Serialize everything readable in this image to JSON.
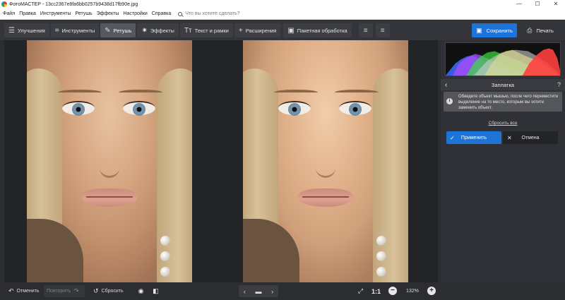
{
  "window": {
    "title": "ФотоМАСТЕР - 13cc2367e8fa6bb0257b9438d17fb90e.jpg",
    "controls": [
      "—",
      "☐",
      "✕"
    ]
  },
  "menu": {
    "items": [
      "Файл",
      "Правка",
      "Инструменты",
      "Ретушь",
      "Эффекты",
      "Настройки",
      "Справка"
    ],
    "search_placeholder": "Что вы хотите сделать?"
  },
  "toolbar": {
    "tabs": [
      {
        "label": "Улучшения",
        "icon": "sliders-icon",
        "glyph": "☰"
      },
      {
        "label": "Инструменты",
        "icon": "crop-icon",
        "glyph": "⌗"
      },
      {
        "label": "Ретушь",
        "icon": "brush-icon",
        "glyph": "✎"
      },
      {
        "label": "Эффекты",
        "icon": "magic-wand-icon",
        "glyph": "✷"
      },
      {
        "label": "Текст и рамки",
        "icon": "text-icon",
        "glyph": "Tт"
      },
      {
        "label": "Расширения",
        "icon": "plus-icon",
        "glyph": "+"
      }
    ],
    "active_tab": "Ретушь",
    "batch_label": "Пакетная обработка",
    "save_label": "Сохранить",
    "print_label": "Печать"
  },
  "panel": {
    "title": "Заплатка",
    "help": "?",
    "hint": "Обведите объект мышью, после чего переместите выделение на то место, которым вы хотите заменить объект.",
    "reset_all": "Сбросить все",
    "apply": "Применить",
    "cancel": "Отмена"
  },
  "bottom": {
    "undo": "Отменить",
    "redo": "Повторить",
    "reset": "Сбросить",
    "ratio": "1:1",
    "zoom": "132%"
  },
  "colors": {
    "accent": "#1e73d8",
    "background": "#2b2d31",
    "panel": "#2f3136"
  }
}
